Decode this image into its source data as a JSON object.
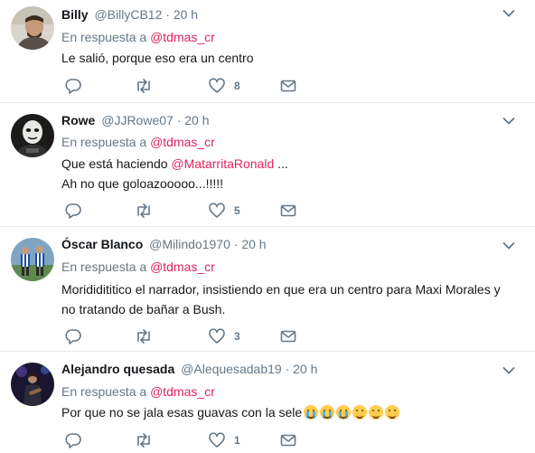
{
  "tweets": [
    {
      "name": "Billy",
      "handle": "@BillyCB12",
      "time": "20 h",
      "reply_prefix": "En respuesta a",
      "reply_to": "@tdmas_cr",
      "text_line1": "Le salió, porque eso era un centro",
      "likes": "8",
      "avatar_icon": "man-portrait-avatar"
    },
    {
      "name": "Rowe",
      "handle": "@JJRowe07",
      "time": "20 h",
      "reply_prefix": "En respuesta a",
      "reply_to": "@tdmas_cr",
      "text_prefix": "Que está haciendo ",
      "text_mention": "@MatarritaRonald",
      "text_suffix": " ...",
      "text_line2": "Ah no que goloazooooo...!!!!!",
      "likes": "5",
      "avatar_icon": "masked-figure-avatar"
    },
    {
      "name": "Óscar Blanco",
      "handle": "@Milindo1970",
      "time": "20 h",
      "reply_prefix": "En respuesta a",
      "reply_to": "@tdmas_cr",
      "text_line1": "Morididititico el narrador, insistiendo en que era un centro para Maxi Morales y",
      "text_line2": "no tratando de bañar a Bush.",
      "likes": "3",
      "avatar_icon": "soccer-players-avatar"
    },
    {
      "name": "Alejandro quesada",
      "handle": "@Alequesadab19",
      "time": "20 h",
      "reply_prefix": "En respuesta a",
      "reply_to": "@tdmas_cr",
      "text_line1": "Por que no se jala esas guavas con la sele",
      "likes": "1",
      "avatar_icon": "concert-avatar",
      "emojis": [
        "crying-face",
        "crying-face",
        "crying-face",
        "grinning-face",
        "grinning-face",
        "grinning-face"
      ]
    }
  ],
  "colors": {
    "mention": "#e0245e",
    "secondary_text": "#657786",
    "primary_text": "#14171a",
    "divider": "#e6ecf0"
  }
}
